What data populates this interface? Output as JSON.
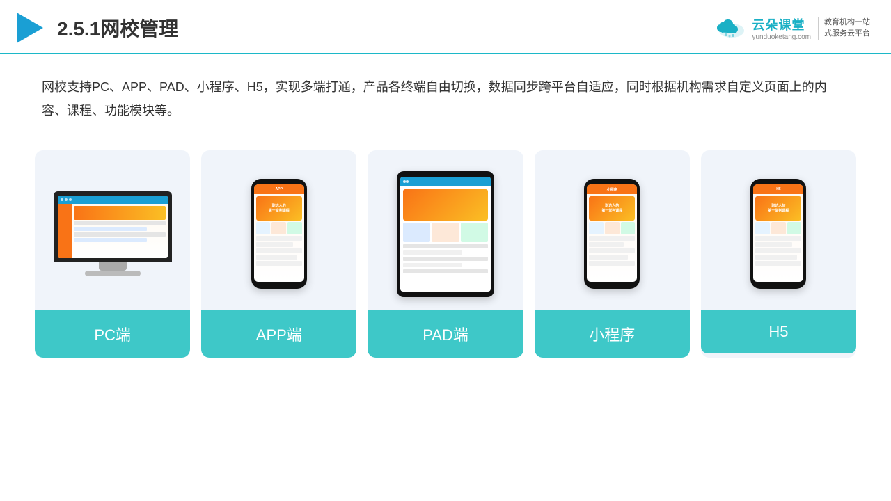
{
  "header": {
    "section_number": "2.5.1",
    "title": "网校管理",
    "brand_name": "云朵课堂",
    "brand_url": "yunduoketang.com",
    "brand_slogan": "教育机构一站\n式服务云平台"
  },
  "description": {
    "text": "网校支持PC、APP、PAD、小程序、H5，实现多端打通，产品各终端自由切换，数据同步跨平台自适应，同时根据机构需求自定义页面上的内容、课程、功能模块等。"
  },
  "cards": [
    {
      "id": "pc",
      "label": "PC端"
    },
    {
      "id": "app",
      "label": "APP端"
    },
    {
      "id": "pad",
      "label": "PAD端"
    },
    {
      "id": "miniprogram",
      "label": "小程序"
    },
    {
      "id": "h5",
      "label": "H5"
    }
  ],
  "colors": {
    "teal": "#3ec8c8",
    "accent_blue": "#1a9fd4",
    "orange": "#f97316",
    "border_bottom": "#1cb8c8"
  }
}
